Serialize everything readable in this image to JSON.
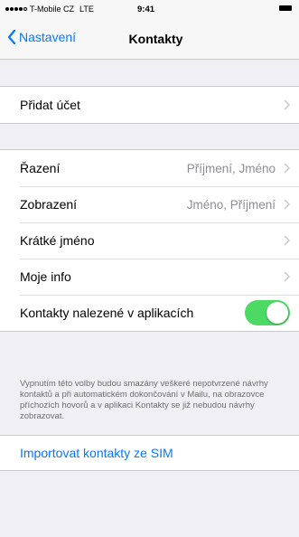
{
  "status_bar": {
    "carrier": "T-Mobile CZ",
    "network": "LTE",
    "time": "9:41"
  },
  "nav": {
    "back_label": "Nastavení",
    "title": "Kontakty"
  },
  "account": {
    "add_account": "Přidat účet"
  },
  "settings": {
    "sort": {
      "label": "Řazení",
      "value": "Příjmení, Jméno"
    },
    "display": {
      "label": "Zobrazení",
      "value": "Jméno, Příjmení"
    },
    "short_name": {
      "label": "Krátké jméno"
    },
    "my_info": {
      "label": "Moje info"
    },
    "found_in_apps": {
      "label": "Kontakty nalezené v aplikacích",
      "enabled": true
    }
  },
  "footnote": "Vypnutím této volby budou smazány veškeré nepotvrzené návrhy kontaktů a při automatickém dokončování v Mailu, na obrazovce příchozích hovorů a v aplikaci Kontakty se již nebudou návrhy zobrazovat.",
  "import_sim": "Importovat kontakty ze SIM",
  "colors": {
    "accent": "#007aff",
    "toggle_on": "#4cd964",
    "background": "#efeff4"
  }
}
